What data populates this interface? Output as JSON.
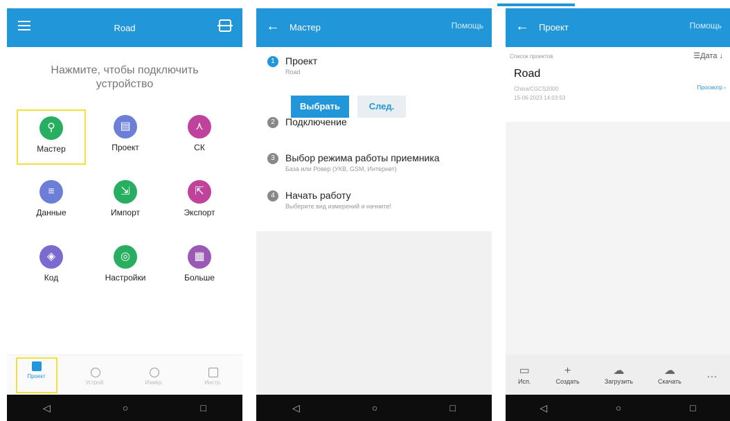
{
  "screen1": {
    "title": "Road",
    "hint": "Нажмите, чтобы подключить устройство",
    "tiles": [
      {
        "label": "Мастер",
        "icon": "signpost-icon",
        "color": "#27ae60",
        "glyph": "⚲"
      },
      {
        "label": "Проект",
        "icon": "document-icon",
        "color": "#6c7fd8",
        "glyph": "▤"
      },
      {
        "label": "СК",
        "icon": "coordinate-system-icon",
        "color": "#c0439b",
        "glyph": "⋏"
      },
      {
        "label": "Данные",
        "icon": "database-icon",
        "color": "#6c7fd8",
        "glyph": "≡"
      },
      {
        "label": "Импорт",
        "icon": "import-icon",
        "color": "#27ae60",
        "glyph": "⇲"
      },
      {
        "label": "Экспорт",
        "icon": "export-icon",
        "color": "#c0439b",
        "glyph": "⇱"
      },
      {
        "label": "Код",
        "icon": "tag-icon",
        "color": "#7a6bd0",
        "glyph": "◈"
      },
      {
        "label": "Настройки",
        "icon": "settings-icon",
        "color": "#27ae60",
        "glyph": "◎"
      },
      {
        "label": "Больше",
        "icon": "grid-icon",
        "color": "#9b59b6",
        "glyph": "▦"
      }
    ],
    "bottom_tabs": [
      {
        "label": "Проект",
        "icon": "project-tab-icon"
      },
      {
        "label": "Устрой.",
        "icon": "device-tab-icon"
      },
      {
        "label": "Измер.",
        "icon": "survey-tab-icon"
      },
      {
        "label": "Инстр.",
        "icon": "tools-tab-icon"
      }
    ]
  },
  "screen2": {
    "title": "Мастер",
    "help": "Помощь",
    "steps": [
      {
        "num": "1",
        "title": "Проект",
        "sub": "Road"
      },
      {
        "num": "2",
        "title": "Подключение",
        "sub": ""
      },
      {
        "num": "3",
        "title": "Выбор режима работы приемника",
        "sub": "База или Ровер (УКВ, GSM, Интернет)"
      },
      {
        "num": "4",
        "title": "Начать работу",
        "sub": "Выберите вид измерений и начните!"
      }
    ],
    "select_label": "Выбрать",
    "next_label": "След."
  },
  "screen3": {
    "title": "Проект",
    "help": "Помощь",
    "list_caption": "Список проектов",
    "sort_label": "Дата",
    "project": {
      "name": "Road",
      "crs": "China/CGCS2000",
      "date": "15-06-2023 14:03:53",
      "view_label": "Просмотр"
    },
    "tools": [
      {
        "label": "Исп.",
        "icon": "folder-icon",
        "glyph": "▭"
      },
      {
        "label": "Создать",
        "icon": "plus-icon",
        "glyph": "+"
      },
      {
        "label": "Загрузить",
        "icon": "cloud-upload-icon",
        "glyph": "☁"
      },
      {
        "label": "Скачать",
        "icon": "cloud-download-icon",
        "glyph": "☁"
      },
      {
        "label": "",
        "icon": "more-icon",
        "glyph": "…"
      }
    ]
  },
  "system_nav": {
    "back": "◁",
    "home": "○",
    "recent": "□"
  },
  "colors": {
    "primary": "#2196d8",
    "highlight": "#f0e23a"
  }
}
